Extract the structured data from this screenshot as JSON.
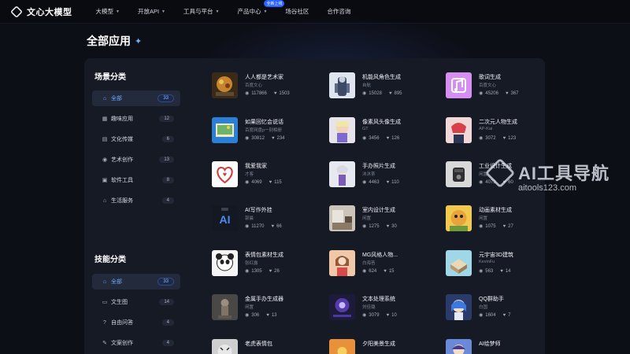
{
  "nav": {
    "logo_text": "文心大模型",
    "items": [
      {
        "label": "大模型",
        "caret": true
      },
      {
        "label": "开放API",
        "caret": true
      },
      {
        "label": "工具与平台",
        "caret": true
      },
      {
        "label": "产品中心",
        "caret": true,
        "badge": "全新上线"
      },
      {
        "label": "场谷社区",
        "caret": false
      },
      {
        "label": "合作咨询",
        "caret": false
      }
    ]
  },
  "page": {
    "title": "全部应用",
    "sparkle": "✦"
  },
  "sidebar": {
    "scene_title": "场景分类",
    "scene_items": [
      {
        "label": "全部",
        "count": "33",
        "active": true,
        "icon": "home-icon"
      },
      {
        "label": "趣味应用",
        "count": "12",
        "active": false,
        "icon": "grid-icon"
      },
      {
        "label": "文化传媒",
        "count": "6",
        "active": false,
        "icon": "book-icon"
      },
      {
        "label": "艺术创作",
        "count": "13",
        "active": false,
        "icon": "palette-icon"
      },
      {
        "label": "软件工具",
        "count": "8",
        "active": false,
        "icon": "briefcase-icon"
      },
      {
        "label": "生活服务",
        "count": "4",
        "active": false,
        "icon": "house-icon"
      }
    ],
    "skill_title": "技能分类",
    "skill_items": [
      {
        "label": "全部",
        "count": "33",
        "active": true,
        "icon": "home-icon"
      },
      {
        "label": "文生图",
        "count": "14",
        "active": false,
        "icon": "image-icon"
      },
      {
        "label": "自由问答",
        "count": "4",
        "active": false,
        "icon": "question-icon"
      },
      {
        "label": "文案创作",
        "count": "4",
        "active": false,
        "icon": "pen-icon"
      }
    ]
  },
  "cards": [
    {
      "title": "人人都是艺术家",
      "author": "百度文心",
      "views": "117866",
      "likes": "1503",
      "thumb": "art"
    },
    {
      "title": "机能风角色生成",
      "author": "自航",
      "views": "15028",
      "likes": "895",
      "thumb": "mech"
    },
    {
      "title": "歌词生成",
      "author": "百度文心",
      "views": "45206",
      "likes": "367",
      "thumb": "music"
    },
    {
      "title": "如果回忆会说话",
      "author": "百度网盘p一别相册",
      "views": "30812",
      "likes": "234",
      "thumb": "photo"
    },
    {
      "title": "像素风头像生成",
      "author": "GT",
      "views": "3456",
      "likes": "126",
      "thumb": "pixel"
    },
    {
      "title": "二次元人物生成",
      "author": "AP-Kai",
      "views": "3072",
      "likes": "123",
      "thumb": "anime"
    },
    {
      "title": "我爱我家",
      "author": "才客",
      "views": "4069",
      "likes": "115",
      "thumb": "home"
    },
    {
      "title": "手办照片生成",
      "author": "沐沐茶",
      "views": "4463",
      "likes": "110",
      "thumb": "figure"
    },
    {
      "title": "工业设计生成",
      "author": "闲置",
      "views": "4073",
      "likes": "60",
      "thumb": "industrial"
    },
    {
      "title": "AI写作外挂",
      "author": "郭晨",
      "views": "11270",
      "likes": "66",
      "thumb": "ai"
    },
    {
      "title": "室内设计生成",
      "author": "闲置",
      "views": "1275",
      "likes": "30",
      "thumb": "interior"
    },
    {
      "title": "动画素材生成",
      "author": "闲置",
      "views": "1075",
      "likes": "27",
      "thumb": "cartoon"
    },
    {
      "title": "表情包素材生成",
      "author": "张红露",
      "views": "1305",
      "likes": "26",
      "thumb": "panda"
    },
    {
      "title": "MG风格人物...",
      "author": "白海苔",
      "views": "624",
      "likes": "15",
      "thumb": "mg"
    },
    {
      "title": "元宇宙3D建筑",
      "author": "KevinFu",
      "views": "563",
      "likes": "14",
      "thumb": "3d"
    },
    {
      "title": "金属手办生成器",
      "author": "闲置",
      "views": "306",
      "likes": "13",
      "thumb": "metal"
    },
    {
      "title": "文本处理系统",
      "author": "刘佳璐",
      "views": "3079",
      "likes": "10",
      "thumb": "text"
    },
    {
      "title": "QQ群助手",
      "author": "白国",
      "views": "1604",
      "likes": "7",
      "thumb": "qq"
    },
    {
      "title": "老虎表情包",
      "author": "",
      "views": "",
      "likes": "",
      "thumb": "tiger"
    },
    {
      "title": "夕阳美景生成",
      "author": "",
      "views": "",
      "likes": "",
      "thumb": "sunset"
    },
    {
      "title": "AI绘梦师",
      "author": "",
      "views": "",
      "likes": "",
      "thumb": "dream"
    }
  ],
  "watermark": {
    "title": "AI工具导航",
    "url": "aitools123.com"
  }
}
